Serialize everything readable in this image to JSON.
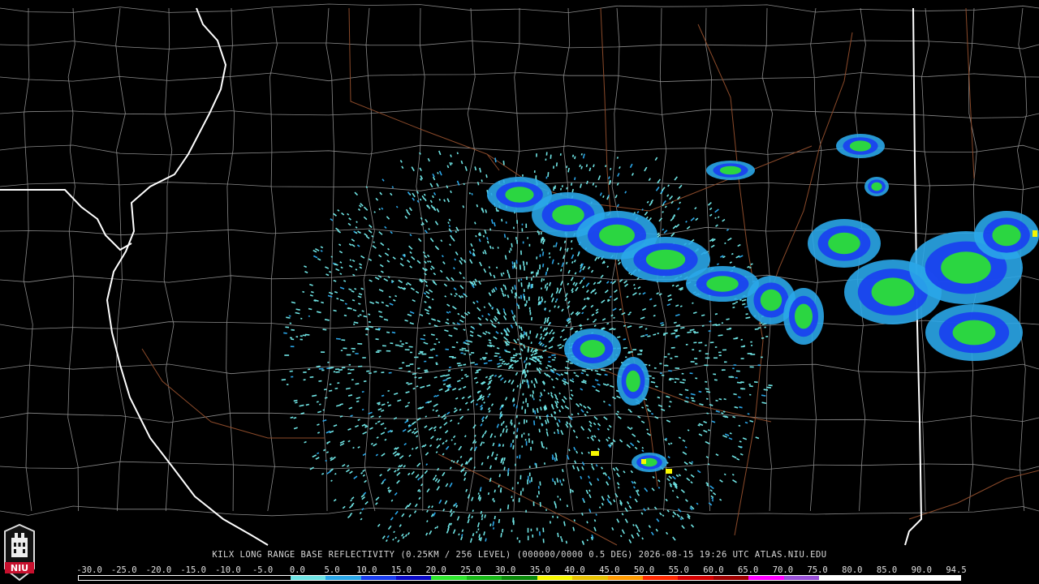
{
  "product": {
    "caption": "KILX LONG RANGE BASE REFLECTIVITY (0.25KM / 256 LEVEL) (000000/0000 0.5 DEG) 2026-08-15 19:26 UTC  ATLAS.NIU.EDU",
    "radar_site": "KILX",
    "timestamp": "2026-08-15 19:26 UTC",
    "source": "ATLAS.NIU.EDU"
  },
  "logo": {
    "text": "NIU",
    "color": "#c8102e"
  },
  "legend": {
    "labels": [
      "-30.0",
      "-25.0",
      "-20.0",
      "-15.0",
      "-10.0",
      "-5.0",
      "0.0",
      "5.0",
      "10.0",
      "15.0",
      "20.0",
      "25.0",
      "30.0",
      "35.0",
      "40.0",
      "45.0",
      "50.0",
      "55.0",
      "60.0",
      "65.0",
      "70.0",
      "75.0",
      "80.0",
      "85.0",
      "90.0",
      "94.5"
    ],
    "colors": [
      "#000000",
      "#000000",
      "#000000",
      "#000000",
      "#000000",
      "#000000",
      "#6fe4e4",
      "#2aa6e8",
      "#1a3ef0",
      "#0a0ac8",
      "#2ee62e",
      "#17b817",
      "#0a8a0a",
      "#f7f700",
      "#e8c200",
      "#ff9a00",
      "#ff2a00",
      "#d40000",
      "#a00000",
      "#ff00ff",
      "#9a50d8",
      "#ffffff",
      "#ffffff",
      "#ffffff",
      "#ffffff"
    ]
  },
  "map_colors": {
    "state_border": "#ffffff",
    "county_lines": "#8a8a8a",
    "roads": "#8b4a2a"
  }
}
